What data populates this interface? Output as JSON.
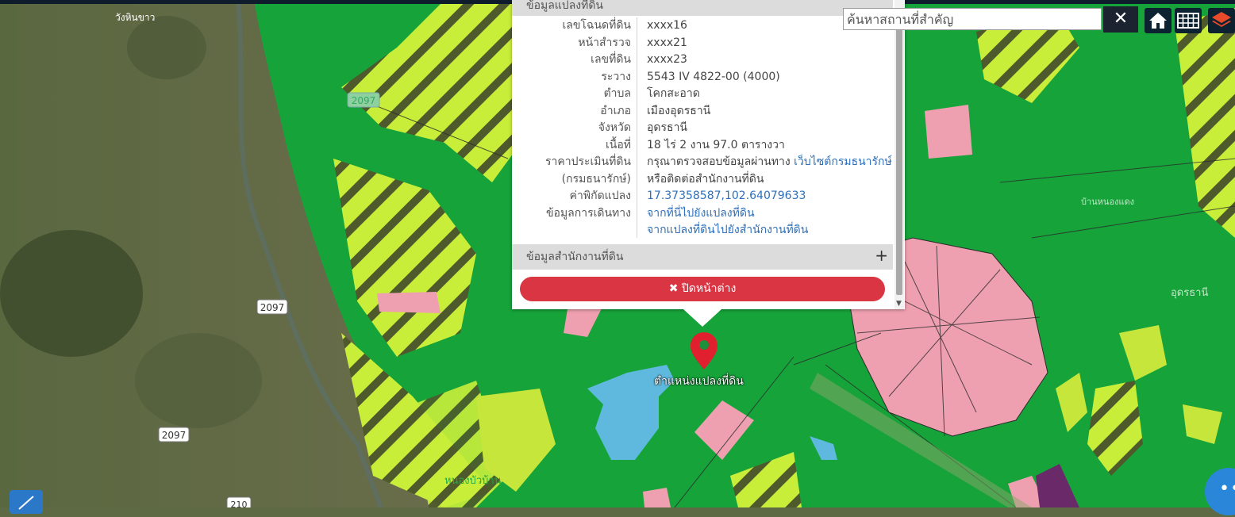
{
  "map": {
    "town_labels": [
      {
        "name": "town-label",
        "text": "วังหินขาว"
      },
      {
        "name": "town-label",
        "text": "อุดรธานี"
      },
      {
        "name": "town-label",
        "text": "บ้านหนองแดง"
      },
      {
        "name": "town-label",
        "text": "หนองบัวบ้าน"
      }
    ],
    "road_badges": [
      "2097",
      "2097",
      "2097",
      "210"
    ],
    "parcel_pin_label": "ตำแหน่งแปลงที่ดิน"
  },
  "search": {
    "placeholder": "ค้นหาสถานที่สำคัญ",
    "clear_icon": "✕"
  },
  "toolbar": {
    "home_icon": "home-icon",
    "grid_icon": "grid-icon",
    "layers_icon": "layers-icon"
  },
  "popup": {
    "header": "ข้อมูลแปลงที่ดิน",
    "rows": [
      {
        "label": "เลขโฉนดที่ดิน",
        "value": "xxxx16"
      },
      {
        "label": "หน้าสำรวจ",
        "value": "xxxx21"
      },
      {
        "label": "เลขที่ดิน",
        "value": "xxxx23"
      },
      {
        "label": "ระวาง",
        "value": "5543 IV 4822-00 (4000)"
      },
      {
        "label": "ตำบล",
        "value": "โคกสะอาด"
      },
      {
        "label": "อำเภอ",
        "value": "เมืองอุดรธานี"
      },
      {
        "label": "จังหวัด",
        "value": "อุดรธานี"
      },
      {
        "label": "เนื้อที่",
        "value": "18 ไร่ 2 งาน 97.0 ตารางวา"
      },
      {
        "label": "ราคาประเมินที่ดิน",
        "value": "กรุณาตรวจสอบข้อมูลผ่านทาง ",
        "link": "เว็บไซต์กรมธนารักษ์"
      },
      {
        "label": "(กรมธนารักษ์)",
        "value": "หรือติดต่อสำนักงานที่ดิน"
      },
      {
        "label": "ค่าพิกัดแปลง",
        "link": "17.37358587,102.64079633"
      },
      {
        "label": "ข้อมูลการเดินทาง",
        "link": "จากที่นี่ไปยังแปลงที่ดิน"
      },
      {
        "label": "",
        "link": "จากแปลงที่ดินไปยังสำนักงานที่ดิน"
      }
    ],
    "office_section": "ข้อมูลสำนักงานที่ดิน",
    "office_toggle": "+",
    "close_label": "✖ ปิดหน้าต่าง"
  },
  "colors": {
    "zone_green": "#15a13a",
    "zone_yellow": "#c4ef3a",
    "zone_pink": "#f0a0b0",
    "water_blue": "#5fb8dd",
    "pin_red": "#e0202e",
    "close_red": "#d93543"
  }
}
